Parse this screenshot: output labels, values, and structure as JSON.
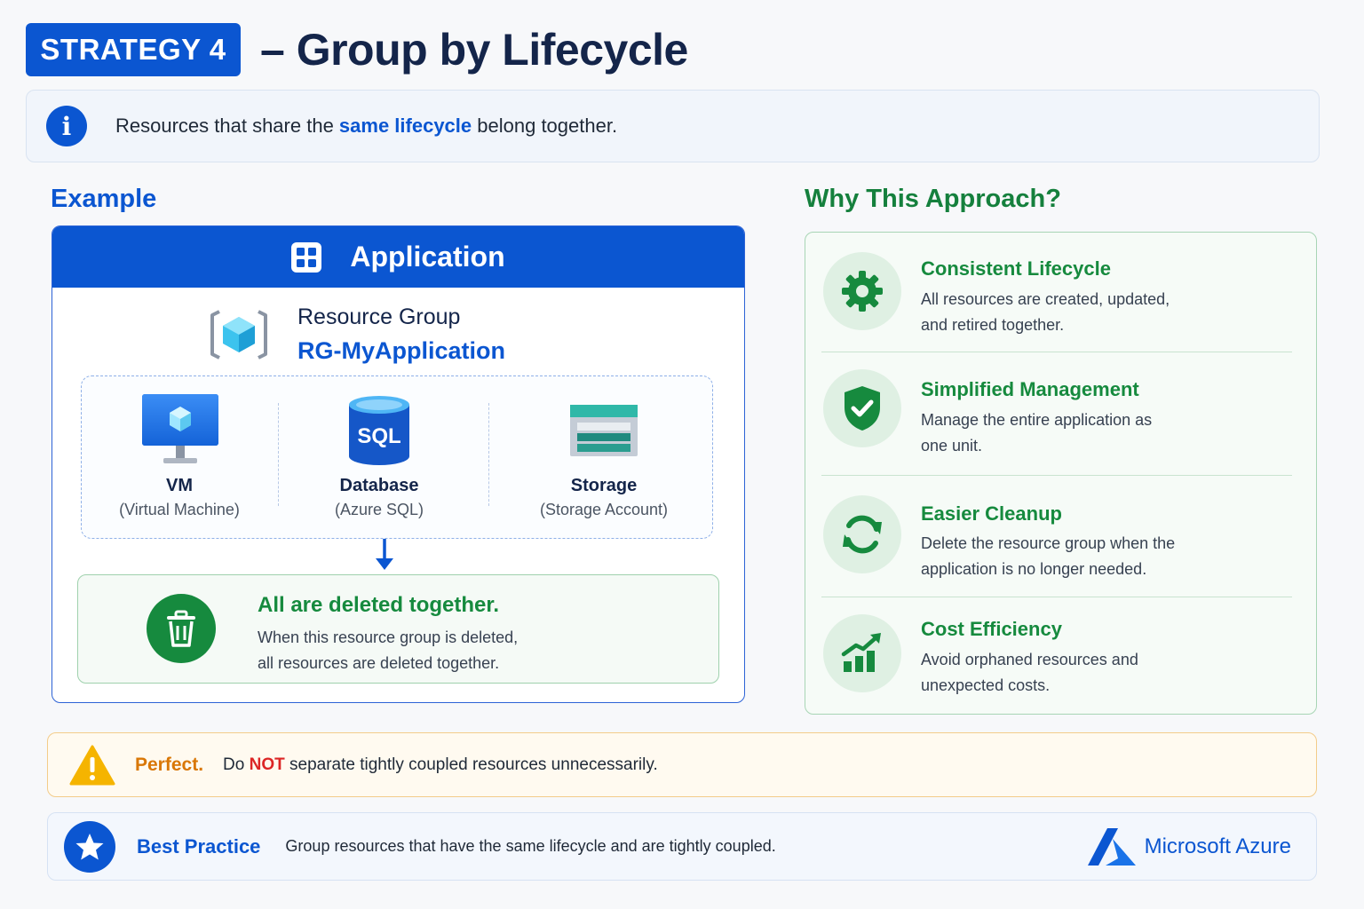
{
  "header": {
    "badge": "STRATEGY 4",
    "title": "– Group by Lifecycle"
  },
  "info": {
    "text_before": "Resources that share the ",
    "highlight": "same lifecycle",
    "text_after": " belong together."
  },
  "example": {
    "section_title": "Example",
    "app_title": "Application",
    "rg_label": "Resource Group",
    "rg_name": "RG-MyApplication",
    "resources": [
      {
        "name": "VM",
        "sub": "(Virtual Machine)",
        "icon": "vm-icon"
      },
      {
        "name": "Database",
        "sub": "(Azure SQL)",
        "icon": "sql-database-icon",
        "icon_text": "SQL"
      },
      {
        "name": "Storage",
        "sub": "(Storage Account)",
        "icon": "storage-icon"
      }
    ],
    "deleted_title": "All are deleted together.",
    "deleted_line1": "When this resource group is deleted,",
    "deleted_line2": "all resources are deleted together."
  },
  "why": {
    "section_title": "Why This Approach?",
    "items": [
      {
        "title": "Consistent Lifecycle",
        "line1": "All resources are created, updated,",
        "line2": "and retired together.",
        "icon": "gear-icon"
      },
      {
        "title": "Simplified Management",
        "line1": "Manage the entire application as",
        "line2": "one unit.",
        "icon": "shield-check-icon"
      },
      {
        "title": "Easier Cleanup",
        "line1": "Delete the resource group when the",
        "line2": "application is no longer needed.",
        "icon": "refresh-icon"
      },
      {
        "title": "Cost Efficiency",
        "line1": "Avoid orphaned resources and",
        "line2": "unexpected costs.",
        "icon": "chart-growth-icon"
      }
    ]
  },
  "warning": {
    "label": "Perfect.",
    "text_before": "Do ",
    "not": "NOT",
    "text_after": " separate tightly coupled resources unnecessarily."
  },
  "best_practice": {
    "label": "Best Practice",
    "text": "Group resources that have the same lifecycle and are tightly coupled.",
    "brand": "Microsoft Azure"
  },
  "colors": {
    "primary_blue": "#0b56d1",
    "green": "#168a3e",
    "warning_orange": "#d97706",
    "danger_red": "#dc2626"
  }
}
